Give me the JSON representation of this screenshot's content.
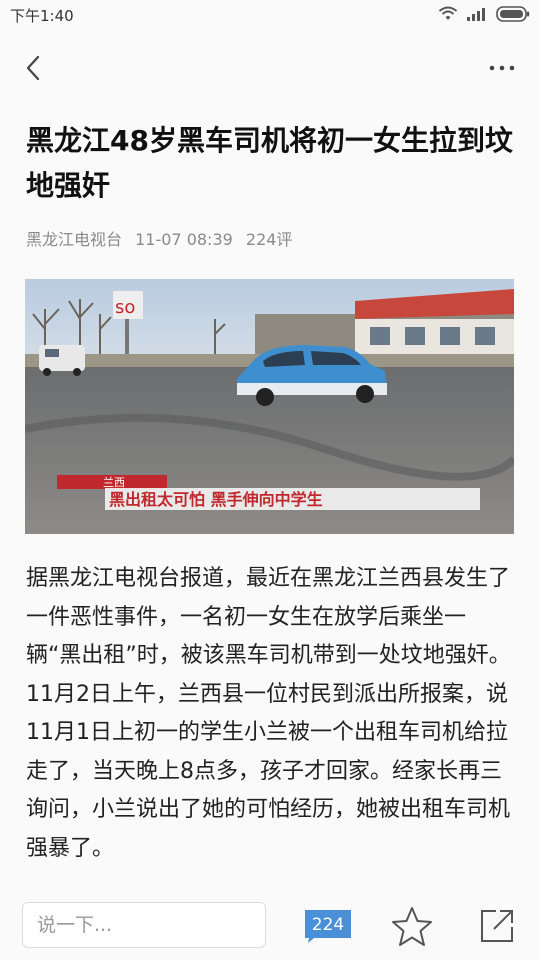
{
  "status_bar": {
    "time": "下午1:40",
    "icons": [
      "wifi-icon",
      "signal-icon",
      "battery-icon"
    ]
  },
  "nav": {
    "back_icon": "chevron-left-icon",
    "more_icon": "more-horizontal-icon"
  },
  "article": {
    "title": "黑龙江48岁黑车司机将初一女生拉到坟地强奸",
    "source": "黑龙江电视台",
    "datetime": "11-07 08:39",
    "comments": "224评",
    "video_caption": {
      "tag": "兰西",
      "headline": "黑出租太可怕 黑手伸向中学生"
    },
    "body": "据黑龙江电视台报道，最近在黑龙江兰西县发生了一件恶性事件，一名初一女生在放学后乘坐一辆“黑出租”时，被该黑车司机带到一处坟地强奸。11月2日上午，兰西县一位村民到派出所报案，说11月1日上初一的学生小兰被一个出租车司机给拉走了，当天晚上8点多，孩子才回家。经家长再三询问，小兰说出了她的可怕经历，她被出租车司机强暴了。"
  },
  "bottom_bar": {
    "comment_placeholder": "说一下...",
    "comment_count": "224",
    "star_icon": "star-icon",
    "share_icon": "share-icon"
  },
  "colors": {
    "badge_blue": "#4a90d9",
    "meta_gray": "#8a8a8a",
    "caption_red": "#c0282d"
  }
}
